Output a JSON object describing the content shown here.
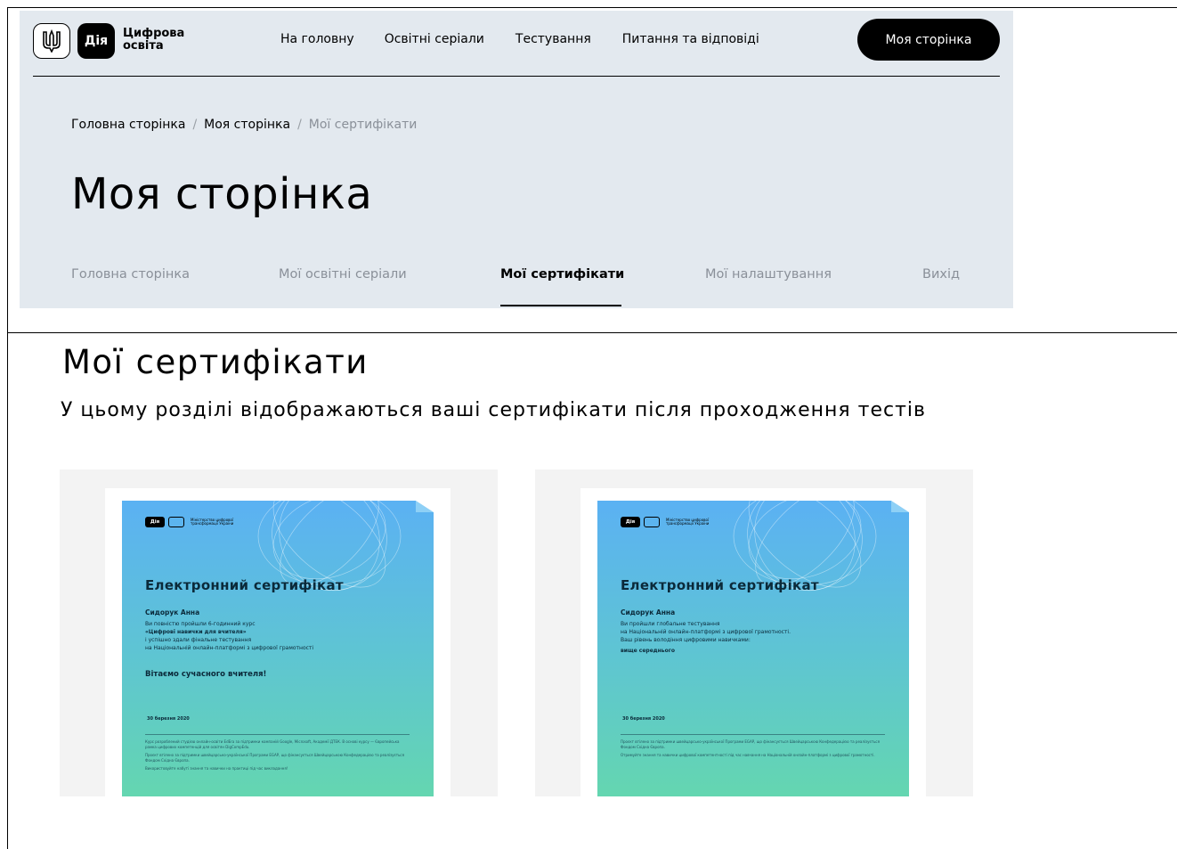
{
  "header": {
    "diia_badge": "Дія",
    "brand_line1": "Цифрова",
    "brand_line2": "освіта",
    "nav": [
      "На головну",
      "Освітні серіали",
      "Тестування",
      "Питання та відповіді"
    ],
    "my_page_button": "Моя сторінка"
  },
  "breadcrumb": {
    "items": [
      "Головна сторінка",
      "Моя сторінка",
      "Мої сертифікати"
    ],
    "separator": "/"
  },
  "page_title": "Моя сторінка",
  "tabs": [
    {
      "label": "Головна сторінка",
      "active": false
    },
    {
      "label": "Мої освітні серіали",
      "active": false
    },
    {
      "label": "Мої сертифікати",
      "active": true
    },
    {
      "label": "Мої налаштування",
      "active": false
    },
    {
      "label": "Вихід",
      "active": false
    }
  ],
  "section": {
    "title": "Мої сертифікати",
    "subtitle": "У цьому розділі відображаються ваші сертифікати після проходження тестів"
  },
  "certificates": [
    {
      "badge": "Дія",
      "ministry": "Міністерство цифрової трансформації України",
      "title": "Електронний сертифікат",
      "name": "Сидорук Анна",
      "line1": "Ви повністю пройшли 6-годинний курс",
      "line2": "«Цифрові навички для вчителя»",
      "line3": "і успішно здали фінальне тестування",
      "line4": "на Національній онлайн-платформі з цифрової грамотності",
      "congrats": "Вітаємо сучасного вчителя!",
      "date": "30 березня 2020",
      "fine1": "Курс розроблений студією онлайн-освіти EdEra за підтримки компаній Google, Microsoft, Академії ДТЕК. В основі курсу — Європейська рамка цифрових компетенцій для освітян DigCompEdu.",
      "fine2": "Проєкт втілено за підтримки швейцарсько-української Програми EGAP, що фінансується Швейцарською Конфедерацією та реалізується Фондом Східна Європа.",
      "fine3": "Використовуйте набуті знання та навички на практиці під час викладання!"
    },
    {
      "badge": "Дія",
      "ministry": "Міністерство цифрової трансформації України",
      "title": "Електронний сертифікат",
      "name": "Сидорук Анна",
      "line1": "Ви пройшли глобальне тестування",
      "line2": "на Національній онлайн-платформі з цифрової грамотності.",
      "line3": "Ваш рівень володіння цифровими навичками:",
      "line4": "вище середнього",
      "date": "30 березня 2020",
      "fine1": "Проєкт втілено за підтримки швейцарсько-української Програми EGAP, що фінансується Швейцарською Конфедерацією та реалізується Фондом Східна Європа.",
      "fine2": "Отримуйте знання та навички цифрової компетентності під час навчання на Національній онлайн-платформі з цифрової грамотності."
    }
  ],
  "colors": {
    "panel_bg": "#e3e9ef",
    "card_bg": "#f3f3f3",
    "cert_gradient_top": "#5bb1f3",
    "cert_gradient_bottom": "#64d6b0",
    "muted_text": "#8a9099"
  },
  "icons": [
    "trident-emblem-icon",
    "diia-logo-icon"
  ]
}
